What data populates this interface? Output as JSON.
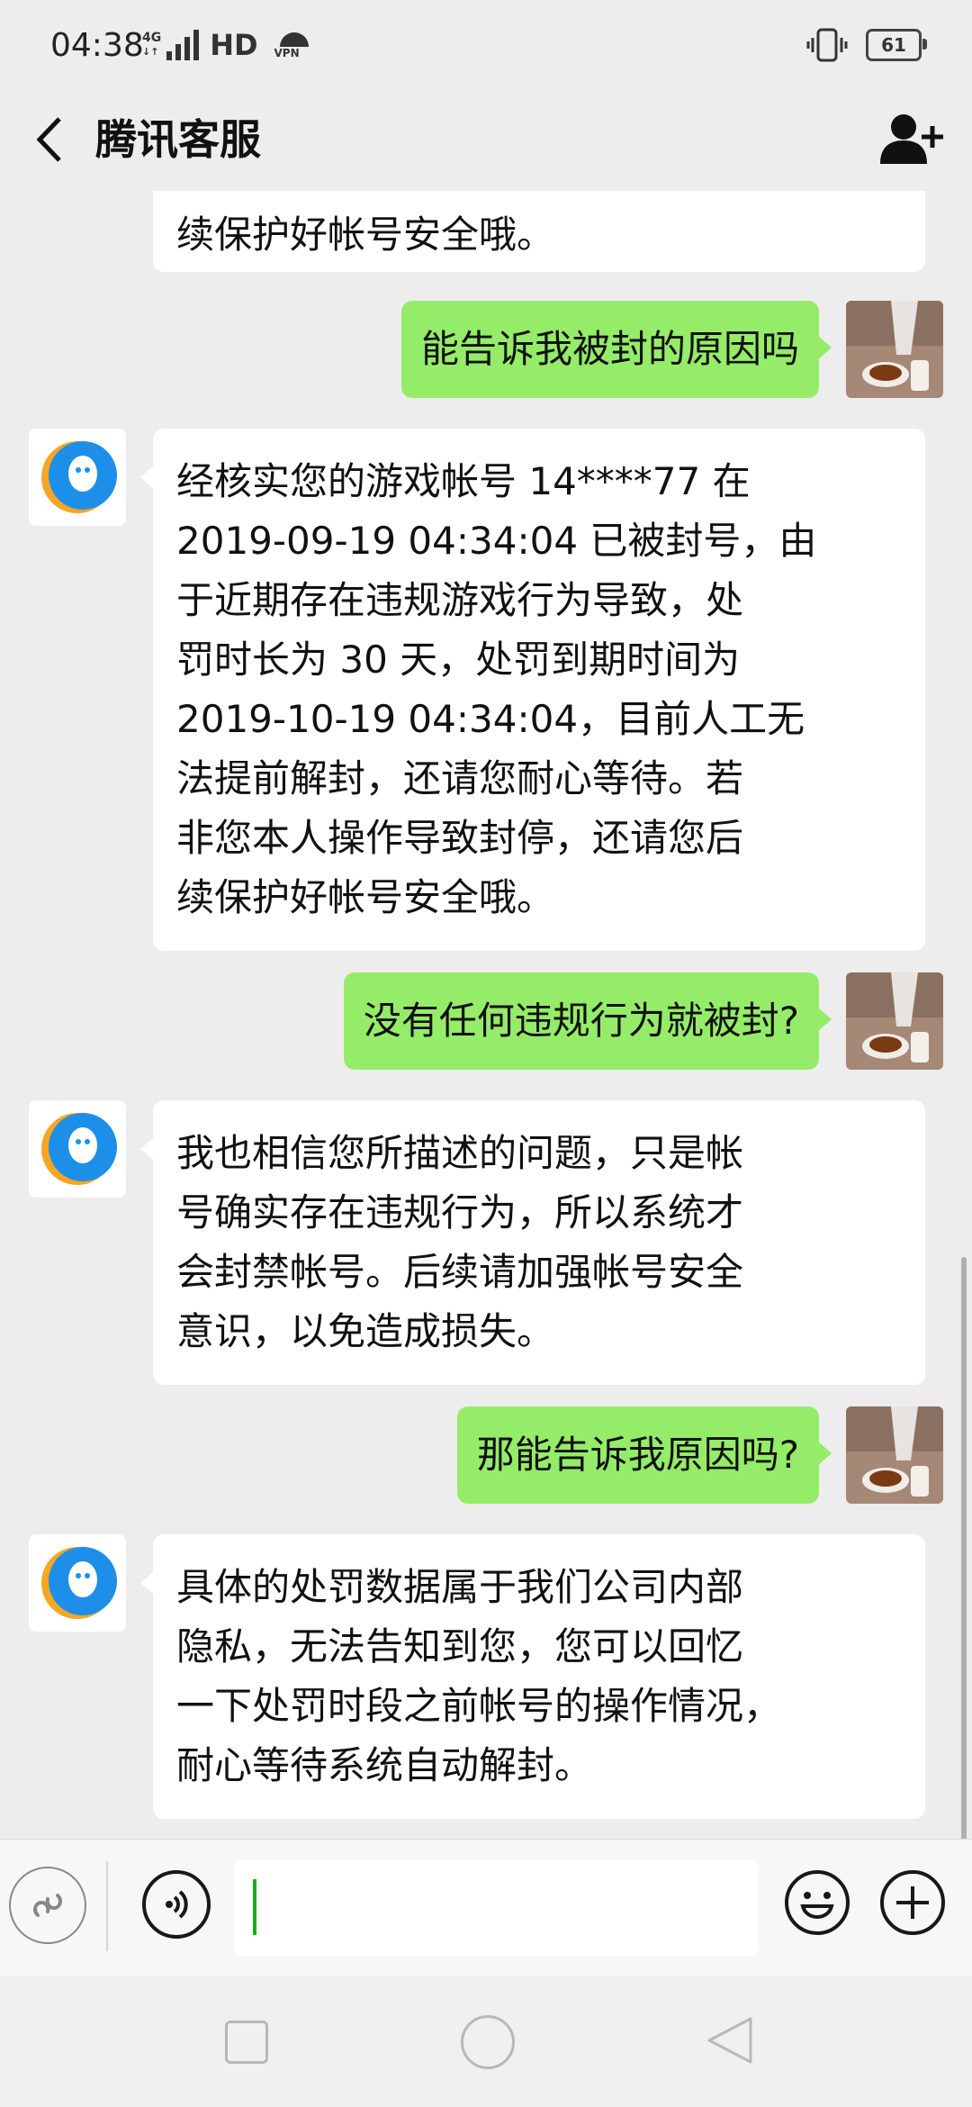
{
  "status_bar": {
    "time": "04:38",
    "network_badge_top": "4G",
    "network_badge_bottom": "↓↑",
    "hd_label": "HD",
    "vpn_label": "VPN",
    "battery_level": "61"
  },
  "header": {
    "title": "腾讯客服",
    "back_icon": "chevron-left-icon",
    "action_icon": "add-user-icon"
  },
  "messages": [
    {
      "sender": "service",
      "text": "续保护好帐号安全哦。"
    },
    {
      "sender": "user",
      "text": "能告诉我被封的原因吗"
    },
    {
      "sender": "service",
      "lines": [
        "经核实您的游戏帐号 14****77 在",
        "2019-09-19 04:34:04 已被封号，由",
        "于近期存在违规游戏行为导致，处",
        "罚时长为 30 天，处罚到期时间为",
        "2019-10-19 04:34:04，目前人工无",
        "法提前解封，还请您耐心等待。若",
        "非您本人操作导致封停，还请您后",
        "续保护好帐号安全哦。"
      ]
    },
    {
      "sender": "user",
      "text": "没有任何违规行为就被封?"
    },
    {
      "sender": "service",
      "lines": [
        "我也相信您所描述的问题，只是帐",
        "号确实存在违规行为，所以系统才",
        "会封禁帐号。后续请加强帐号安全",
        "意识，以免造成损失。"
      ]
    },
    {
      "sender": "user",
      "text": "那能告诉我原因吗?"
    },
    {
      "sender": "service",
      "lines": [
        "具体的处罚数据属于我们公司内部",
        "隐私，无法告知到您，您可以回忆",
        "一下处罚时段之前帐号的操作情况，",
        "耐心等待系统自动解封。"
      ]
    }
  ],
  "input_bar": {
    "mini_program_icon": "link-icon",
    "voice_icon": "voice-icon",
    "input_value": "",
    "emoji_icon": "emoji-icon",
    "more_icon": "plus-icon"
  },
  "colors": {
    "background": "#ededed",
    "outgoing_bubble": "#95ec69",
    "incoming_bubble": "#ffffff",
    "cursor": "#1aad19",
    "service_avatar_blue": "#1e8fe8",
    "service_avatar_orange": "#f5a623"
  }
}
